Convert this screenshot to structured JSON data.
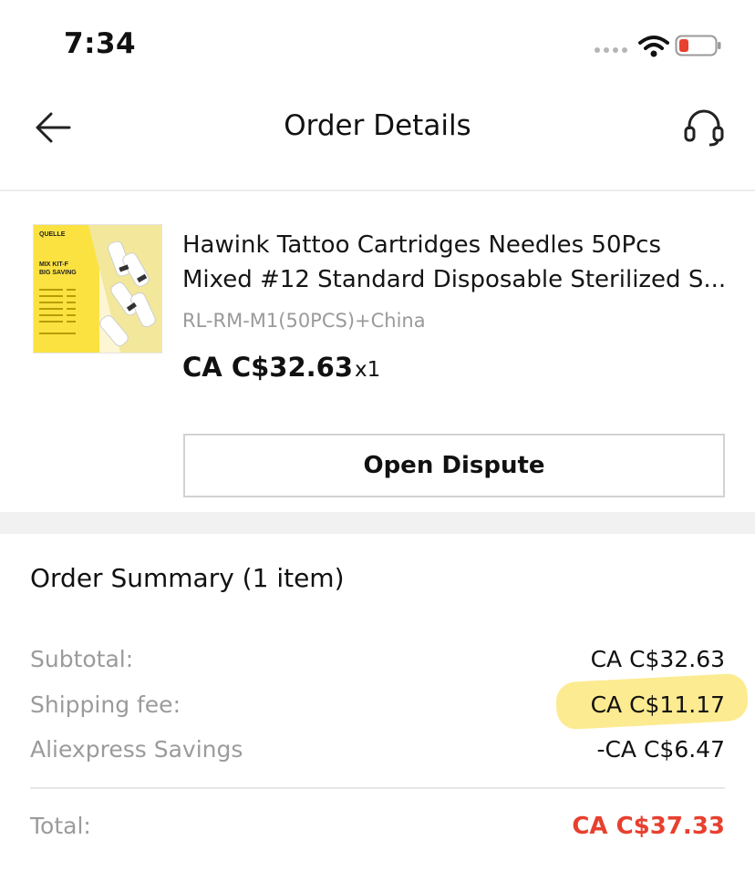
{
  "status_bar": {
    "time": "7:34"
  },
  "header": {
    "title": "Order Details"
  },
  "product": {
    "thumbnail_text": {
      "brand": "QUELLE",
      "kit": "MIX KIT-F",
      "saving": "BIG SAVING"
    },
    "title": "Hawink Tattoo Cartridges Needles 50Pcs Mixed #12 Standard Disposable Sterilized S...",
    "variant": "RL-RM-M1(50PCS)+China",
    "price": "CA C$32.63",
    "quantity": "x1"
  },
  "actions": {
    "open_dispute": "Open Dispute"
  },
  "summary": {
    "title": "Order Summary (1 item)",
    "rows": [
      {
        "label": "Subtotal:",
        "value": "CA C$32.63"
      },
      {
        "label": "Shipping fee:",
        "value": "CA C$11.17"
      },
      {
        "label": "Aliexpress Savings",
        "value": "-CA C$6.47"
      }
    ],
    "total_label": "Total:",
    "total_value": "CA C$37.33"
  },
  "colors": {
    "total_accent": "#e8402f",
    "highlight": "#fbe46b",
    "battery_low": "#e8402f"
  }
}
